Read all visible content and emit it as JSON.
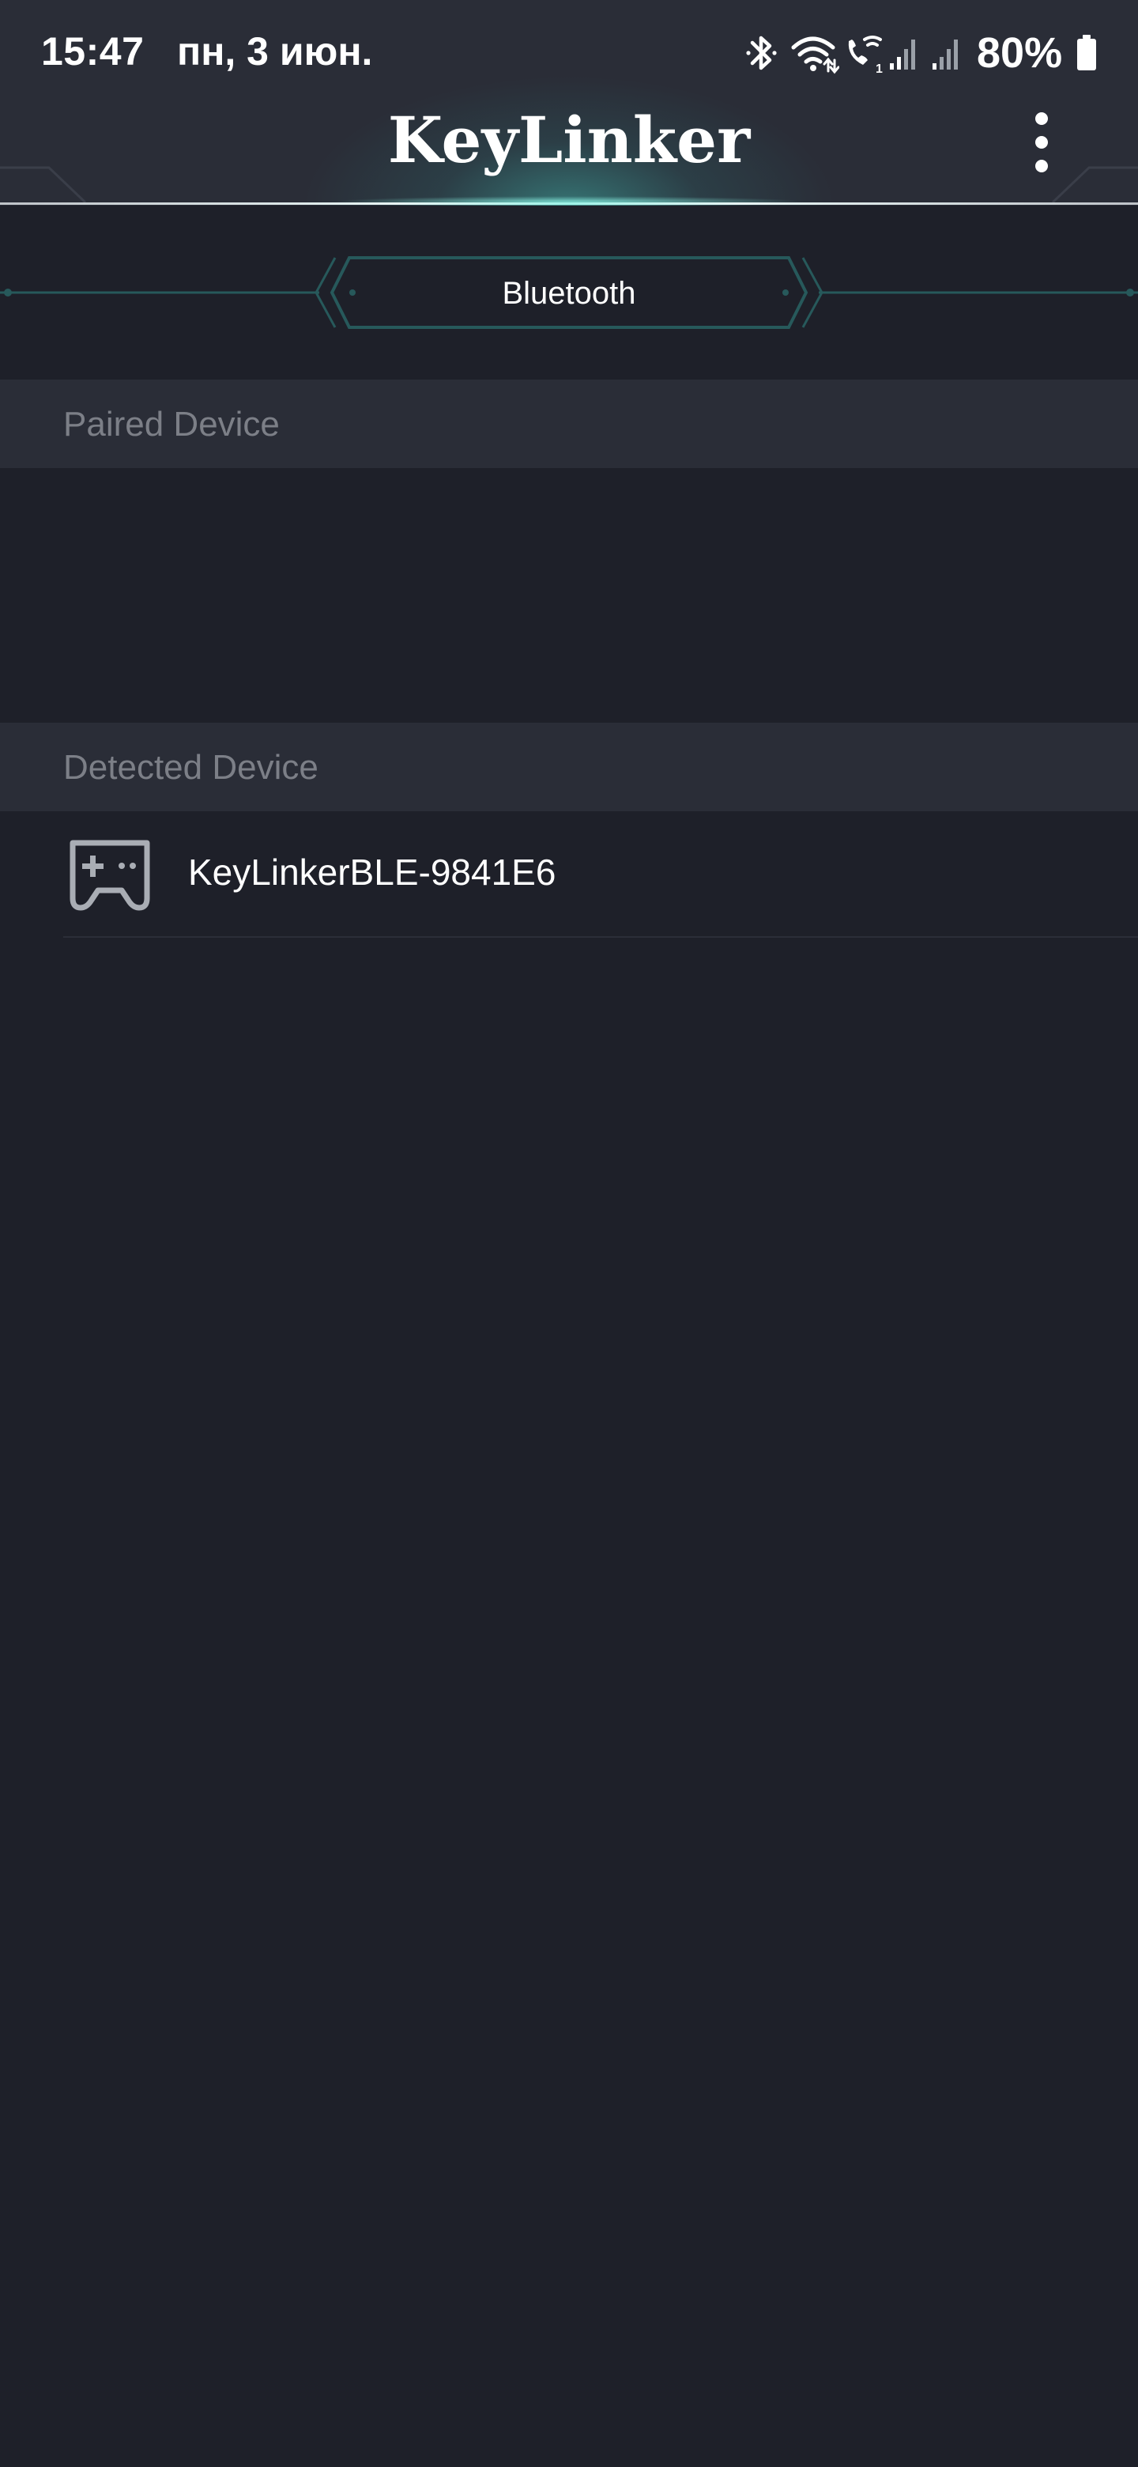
{
  "status_bar": {
    "time": "15:47",
    "date": "пн, 3 июн.",
    "battery": "80%",
    "icons": [
      "bluetooth-icon",
      "wifi-icon",
      "wifi-calling-icon",
      "signal-icon",
      "signal-icon",
      "battery-icon"
    ]
  },
  "app_bar": {
    "title": "KeyLinker",
    "menu_icon": "more-vert-icon"
  },
  "tabs": {
    "active": "Bluetooth"
  },
  "sections": {
    "paired": {
      "title": "Paired Device",
      "devices": []
    },
    "detected": {
      "title": "Detected Device",
      "devices": [
        {
          "name": "KeyLinkerBLE-9841E6",
          "icon": "gamepad-icon"
        }
      ]
    }
  },
  "colors": {
    "background": "#1e2029",
    "header": "#2a2d37",
    "section_header": "#2a2d37",
    "section_text": "#7c7f87",
    "accent": "#2a6b6b",
    "glow": "#9ff3e8"
  }
}
